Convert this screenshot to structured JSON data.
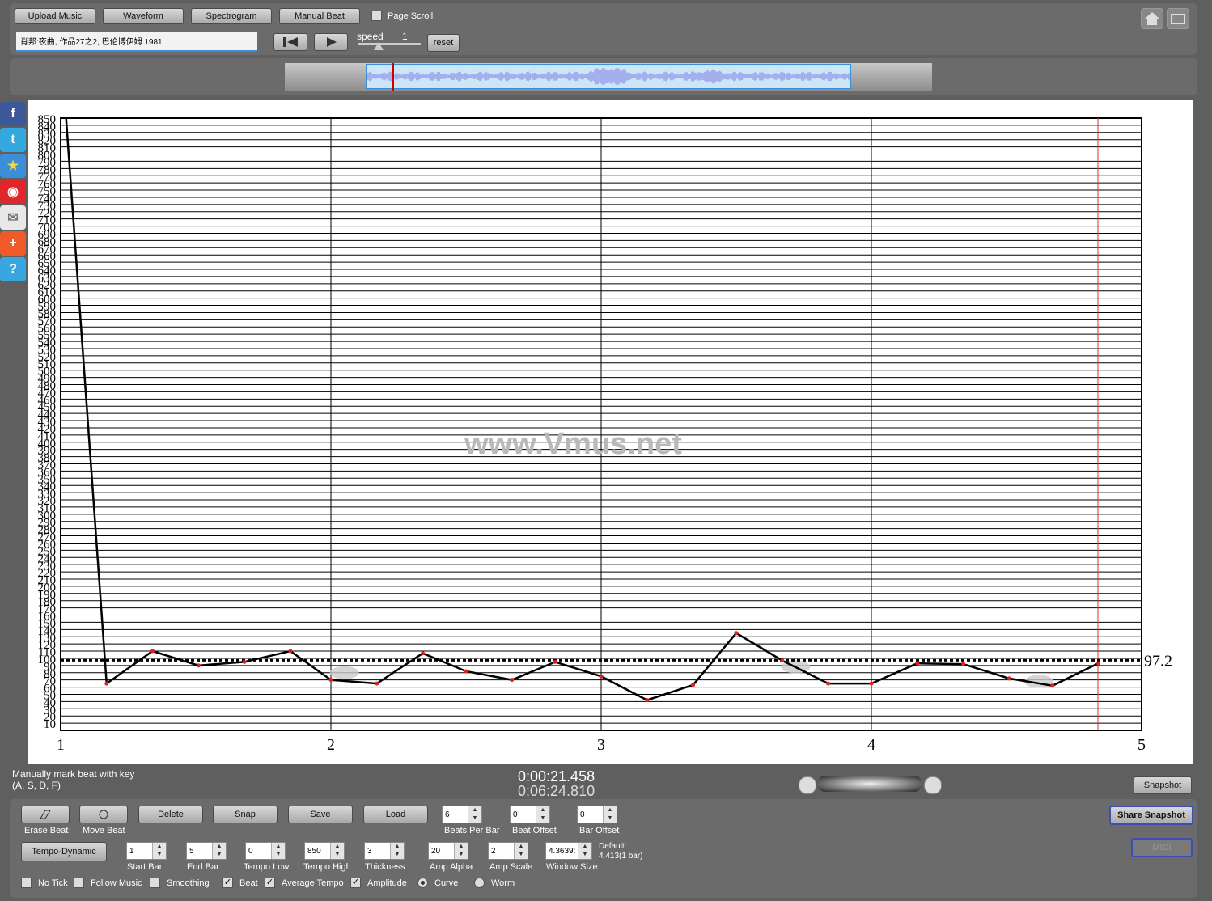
{
  "toolbar": {
    "upload": "Upload Music",
    "waveform": "Waveform",
    "spectrogram": "Spectrogram",
    "manual_beat": "Manual Beat",
    "page_scroll": "Page Scroll"
  },
  "song_title": "肖邦:夜曲, 作品27之2, 巴伦博伊姆 1981",
  "playback": {
    "speed_label": "speed",
    "speed_value": "1",
    "reset": "reset"
  },
  "chart_data": {
    "type": "line",
    "title": "",
    "watermark": "www.Vmus.net",
    "xlim": [
      1,
      5
    ],
    "ylim": [
      0,
      850
    ],
    "x_ticks": [
      "1",
      "2",
      "3",
      "4",
      "5"
    ],
    "y_tick_step": 10,
    "average_value": 97.2,
    "average_label": "97.2",
    "series": [
      {
        "x": [
          1.02,
          1.17,
          1.34,
          1.51,
          1.68,
          1.85,
          2.0,
          2.17,
          2.34,
          2.5,
          2.67,
          2.83,
          3.0,
          3.17,
          3.34,
          3.5,
          3.67,
          3.84,
          4.0,
          4.17,
          4.34,
          4.51,
          4.67,
          4.84
        ],
        "y": [
          850,
          65,
          110,
          90,
          95,
          110,
          70,
          65,
          107,
          82,
          70,
          95,
          75,
          42,
          63,
          135,
          97,
          65,
          65,
          93,
          92,
          72,
          62,
          93
        ]
      }
    ]
  },
  "status": {
    "hint1": "Manually mark beat with key",
    "hint2": "(A, S, D, F)",
    "time_current": "0:00:21.458",
    "time_total": "0:06:24.810",
    "snapshot": "Snapshot"
  },
  "controls": {
    "erase_beat": "Erase Beat",
    "move_beat": "Move Beat",
    "delete": "Delete",
    "snap": "Snap",
    "save": "Save",
    "load": "Load",
    "beats_per_bar": {
      "label": "Beats Per Bar",
      "value": "6"
    },
    "beat_offset": {
      "label": "Beat Offset",
      "value": "0"
    },
    "bar_offset": {
      "label": "Bar Offset",
      "value": "0"
    },
    "share_snapshot": "Share Snapshot",
    "tempo_dynamic": "Tempo-Dynamic",
    "start_bar": {
      "label": "Start Bar",
      "value": "1"
    },
    "end_bar": {
      "label": "End Bar",
      "value": "5"
    },
    "tempo_low": {
      "label": "Tempo Low",
      "value": "0"
    },
    "tempo_high": {
      "label": "Tempo High",
      "value": "850"
    },
    "thickness": {
      "label": "Thickness",
      "value": "3"
    },
    "amp_alpha": {
      "label": "Amp Alpha",
      "value": "20"
    },
    "amp_scale": {
      "label": "Amp Scale",
      "value": "2"
    },
    "window_size": {
      "label": "Window Size",
      "value": "4.3639:"
    },
    "default_label": "Default:",
    "default_value": "4.413(1 bar)",
    "no_tick": "No Tick",
    "follow_music": "Follow Music",
    "smoothing": "Smoothing",
    "beat": "Beat",
    "average_tempo": "Average Tempo",
    "amplitude": "Amplitude",
    "curve": "Curve",
    "worm": "Worm",
    "midi": "MIDI"
  }
}
